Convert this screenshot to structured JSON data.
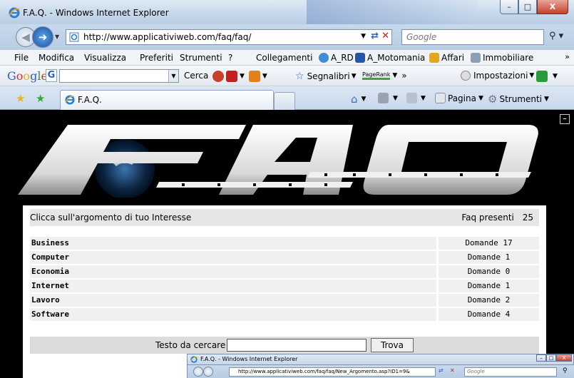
{
  "window": {
    "title": "F.A.Q. - Windows Internet Explorer",
    "min": "–",
    "max": "□",
    "close": "X"
  },
  "address": {
    "url": "http://www.applicativiweb.com/faq/faq/",
    "search_placeholder": "Google"
  },
  "menu": [
    "File",
    "Modifica",
    "Visualizza",
    "Preferiti",
    "Strumenti",
    "?"
  ],
  "links": {
    "label": "Collegamenti",
    "items": [
      "A_RD",
      "A_Motomania",
      "Affari",
      "Immobiliare"
    ]
  },
  "google_toolbar": {
    "logo": "Google",
    "search_button": "Cerca",
    "bookmarks": "Segnalibri",
    "pagerank": "PageRank",
    "settings": "Impostazioni"
  },
  "tab": {
    "label": "F.A.Q."
  },
  "commands": {
    "page": "Pagina",
    "tools": "Strumenti"
  },
  "faq": {
    "header_left": "Clicca sull'argomento di tuo Interesse",
    "header_right_label": "Faq presenti",
    "header_right_count": "25",
    "topics": [
      {
        "name": "Business",
        "count": "Domande 17"
      },
      {
        "name": "Computer",
        "count": "Domande 1"
      },
      {
        "name": "Economia",
        "count": "Domande 0"
      },
      {
        "name": "Internet",
        "count": "Domande 1"
      },
      {
        "name": "Lavoro",
        "count": "Domande 2"
      },
      {
        "name": "Software",
        "count": "Domande 4"
      }
    ],
    "search_label": "Testo da cercare",
    "search_value": "",
    "search_button": "Trova"
  },
  "second_window": {
    "title": "F.A.Q. - Windows Internet Explorer",
    "url": "http://www.applicativiweb.com/faq/faq/New_Argomento.asp?ID1=9&",
    "search_placeholder": "Google"
  },
  "colors": {
    "page_bg": "#000000",
    "panel_bg": "#ffffff",
    "row_bg": "#f0f0f0",
    "header_bg": "#e6e6e6"
  }
}
